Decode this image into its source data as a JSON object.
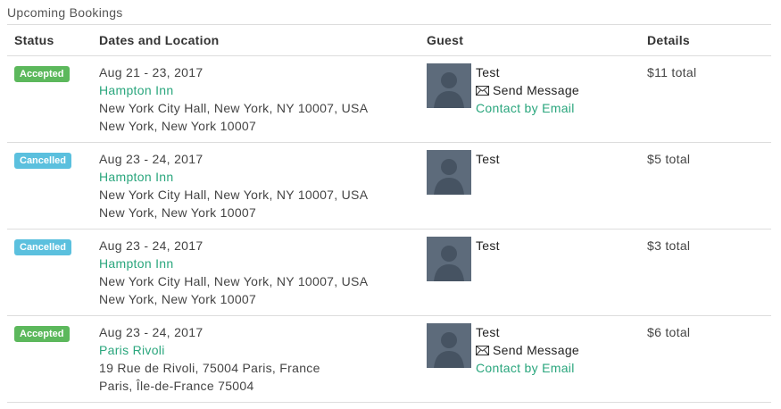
{
  "panel": {
    "title": "Upcoming Bookings"
  },
  "table": {
    "headers": {
      "status": "Status",
      "dates": "Dates and Location",
      "guest": "Guest",
      "details": "Details"
    },
    "rows": [
      {
        "status": "Accepted",
        "dates": "Aug 21 - 23, 2017",
        "venue": "Hampton Inn",
        "address1": "New York City Hall, New York, NY 10007, USA",
        "address2": "New York, New York 10007",
        "guest_name": "Test",
        "send_message": "Send Message",
        "contact_email": "Contact by Email",
        "details": "$11 total"
      },
      {
        "status": "Cancelled",
        "dates": "Aug 23 - 24, 2017",
        "venue": "Hampton Inn",
        "address1": "New York City Hall, New York, NY 10007, USA",
        "address2": "New York, New York 10007",
        "guest_name": "Test",
        "details": "$5 total"
      },
      {
        "status": "Cancelled",
        "dates": "Aug 23 - 24, 2017",
        "venue": "Hampton Inn",
        "address1": "New York City Hall, New York, NY 10007, USA",
        "address2": "New York, New York 10007",
        "guest_name": "Test",
        "details": "$3 total"
      },
      {
        "status": "Accepted",
        "dates": "Aug 23 - 24, 2017",
        "venue": "Paris Rivoli",
        "address1": "19 Rue de Rivoli, 75004 Paris, France",
        "address2": "Paris, Île-de-France 75004",
        "guest_name": "Test",
        "send_message": "Send Message",
        "contact_email": "Contact by Email",
        "details": "$6 total"
      }
    ]
  },
  "colors": {
    "accepted": "#5cb85c",
    "cancelled": "#5bc0de",
    "link": "#2aa67d",
    "avatar": "#5d6b7b"
  },
  "icons": {
    "avatar": "default-user-avatar-icon",
    "message": "envelope-icon"
  }
}
